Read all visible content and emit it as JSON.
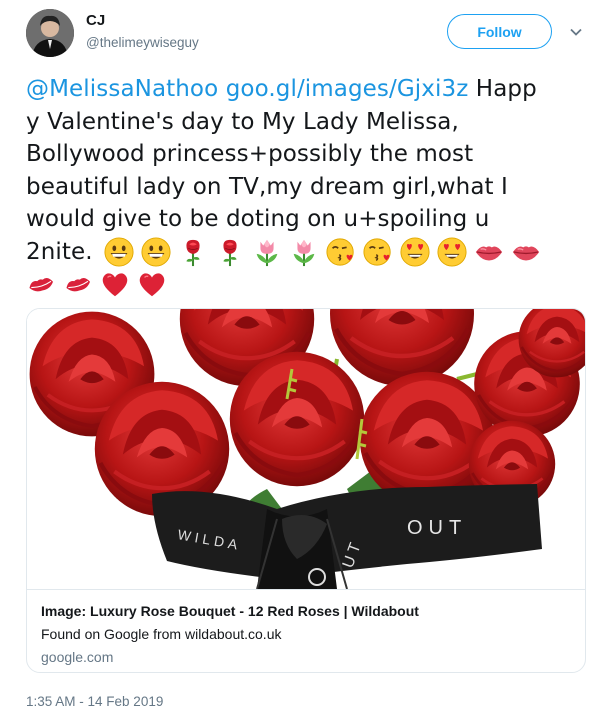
{
  "user": {
    "display_name": "CJ",
    "handle": "@thelimeywiseguy",
    "avatar_icon": "profile-avatar"
  },
  "follow_label": "Follow",
  "tweet": {
    "mention": "@MelissaNathoo",
    "link": "goo.gl/images/Gjxi3z",
    "line1_rest": " Happ",
    "line2": "y Valentine's day to My Lady Melissa,",
    "line3": "Bollywood princess+possibly the most",
    "line4": "beautiful lady on TV,my dream girl,what I",
    "line5": "would give to be doting on u+spoiling u",
    "line6_text": "2nite.",
    "emojis_line6": [
      "grinning-face",
      "grinning-face",
      "rose",
      "rose",
      "tulip",
      "tulip",
      "face-blowing-kiss",
      "face-blowing-kiss",
      "heart-eyes",
      "heart-eyes",
      "lips",
      "lips"
    ],
    "emojis_line7": [
      "kiss-mark",
      "kiss-mark",
      "red-heart",
      "red-heart"
    ]
  },
  "card": {
    "title": "Image: Luxury Rose Bouquet - 12 Red Roses | Wildabout",
    "description": "Found on Google from wildabout.co.uk",
    "domain": "google.com",
    "ribbon_text": "WILDABOUT"
  },
  "timestamp": "1:35 AM - 14 Feb 2019",
  "colors": {
    "link": "#1b95e0",
    "follow": "#1da1f2",
    "muted": "#657786",
    "border": "#e1e8ed"
  }
}
